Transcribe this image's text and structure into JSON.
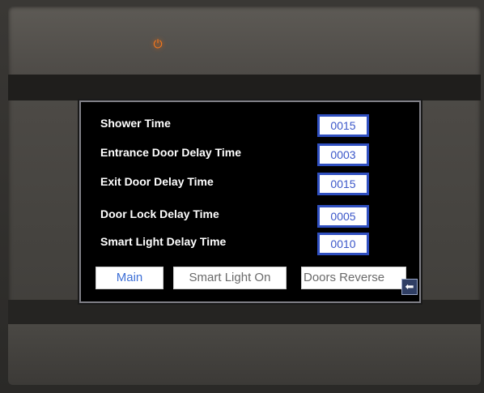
{
  "device": {
    "power_icon": "power-icon",
    "power_glyph": "⏻",
    "led_color": "#ff7a1a"
  },
  "settings": [
    {
      "label": "Shower Time",
      "value": "0015"
    },
    {
      "label": "Entrance Door Delay Time",
      "value": "0003"
    },
    {
      "label": "Exit Door Delay Time",
      "value": "0015"
    },
    {
      "label": "Door Lock Delay Time",
      "value": "0005"
    },
    {
      "label": "Smart Light Delay Time",
      "value": "0010"
    }
  ],
  "buttons": {
    "main": "Main",
    "smart_light_on": "Smart Light On",
    "doors_reverse": "Doors Reverse"
  },
  "back": {
    "icon": "back-arrow-icon",
    "glyph": "⬅"
  },
  "colors": {
    "value_border": "#2f4fc0",
    "value_text": "#3a56c9",
    "main_button_text": "#3d6fd6"
  }
}
